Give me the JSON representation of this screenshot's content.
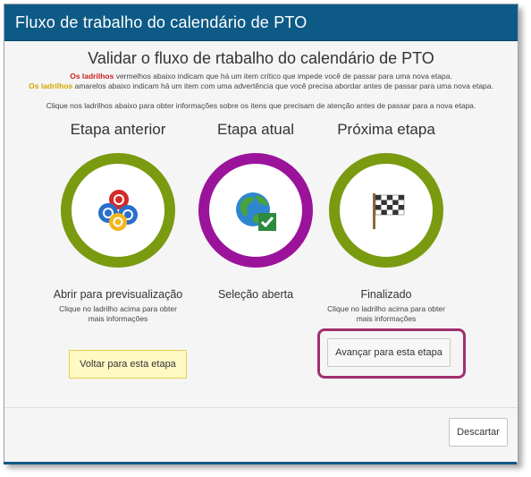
{
  "dialog": {
    "title": "Fluxo de trabalho do calendário de PTO",
    "heading": "Validar o fluxo de rtabalho do calendário de PTO",
    "info": {
      "red_word": "Os ladrilhos",
      "red_text": " vermelhos abaixo indicam que há um item crítico que impede você de passar para uma nova etapa.",
      "yellow_word": "Os ladrilhos",
      "yellow_text": " amarelos abaixo indicam há um item com uma advertência que você precisa abordar antes de passar para uma nova etapa.",
      "click_text": "Clique nos ladrilhos abaixo para obter informações sobre os itens que precisam de atenção antes de passar para a nova etapa."
    }
  },
  "stages": [
    {
      "title": "Etapa anterior",
      "label": "Abrir para previsualização",
      "hint": "Clique no ladrilho acima para obter mais informações",
      "icon": "poker-chips-icon",
      "ring_color": "#7a9a10"
    },
    {
      "title": "Etapa atual",
      "label": "Seleção aberta",
      "hint": "",
      "icon": "globe-check-icon",
      "ring_color": "#9b139b"
    },
    {
      "title": "Próxima etapa",
      "label": "Finalizado",
      "hint": "Clique no ladrilho acima para obter mais informações",
      "icon": "checkered-flag-icon",
      "ring_color": "#7a9a10"
    }
  ],
  "buttons": {
    "back": "Voltar para esta etapa",
    "advance": "Avançar para esta etapa",
    "discard": "Descartar"
  },
  "colors": {
    "titlebar": "#0e5a86",
    "highlight": "#a0306f"
  }
}
